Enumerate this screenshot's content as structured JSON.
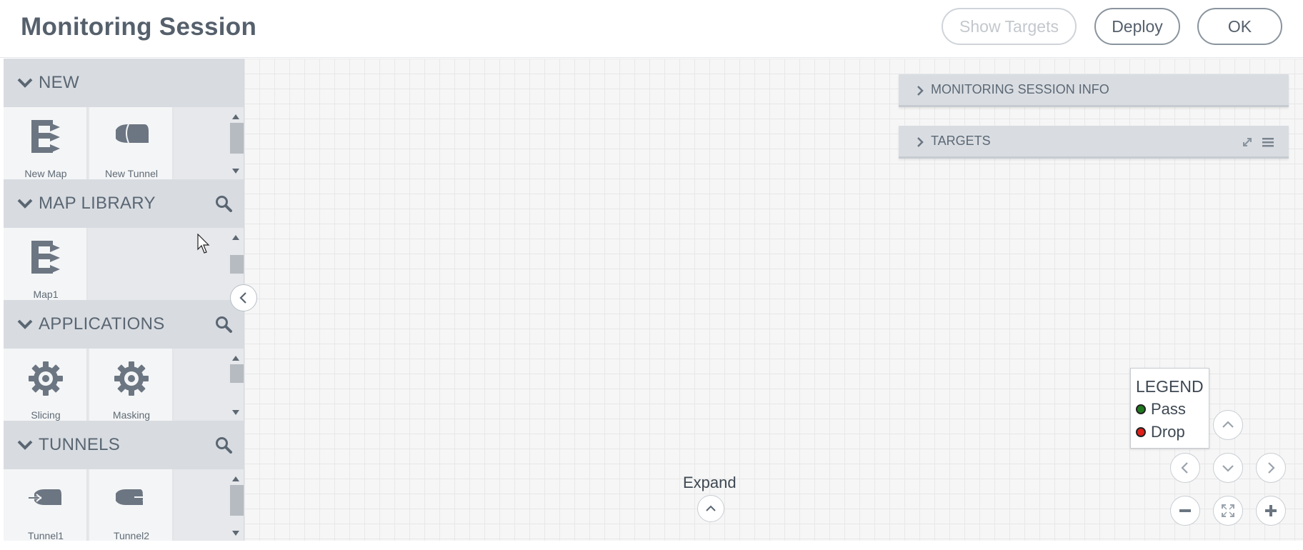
{
  "header": {
    "title": "Monitoring Session",
    "show_targets_label": "Show Targets",
    "deploy_label": "Deploy",
    "ok_label": "OK"
  },
  "sidebar": {
    "sections": [
      {
        "title": "NEW",
        "items": [
          "New Map",
          "New Tunnel"
        ]
      },
      {
        "title": "MAP LIBRARY",
        "items": [
          "Map1"
        ]
      },
      {
        "title": "APPLICATIONS",
        "items": [
          "Slicing",
          "Masking"
        ]
      },
      {
        "title": "TUNNELS",
        "items": [
          "Tunnel1",
          "Tunnel2"
        ]
      }
    ]
  },
  "panels": {
    "session_info": "MONITORING SESSION INFO",
    "targets": "TARGETS"
  },
  "legend": {
    "title": "LEGEND",
    "items": [
      {
        "label": "Pass",
        "color": "#1f7a1f"
      },
      {
        "label": "Drop",
        "color": "#e0201a"
      }
    ]
  },
  "canvas": {
    "expand_label": "Expand"
  },
  "colors": {
    "accent": "#55606c",
    "section_header": "#d8dce1",
    "sidebar_bg": "#e6e8eb",
    "canvas_bg": "#f6f6f6"
  },
  "icons": [
    "chevron-down-icon",
    "search-icon",
    "map-icon",
    "tunnel-icon",
    "gear-icon",
    "chevron-right-icon",
    "expand-icon",
    "menu-icon",
    "chevron-left-icon",
    "chevron-up-icon",
    "minus-icon",
    "plus-icon",
    "fit-screen-icon"
  ]
}
